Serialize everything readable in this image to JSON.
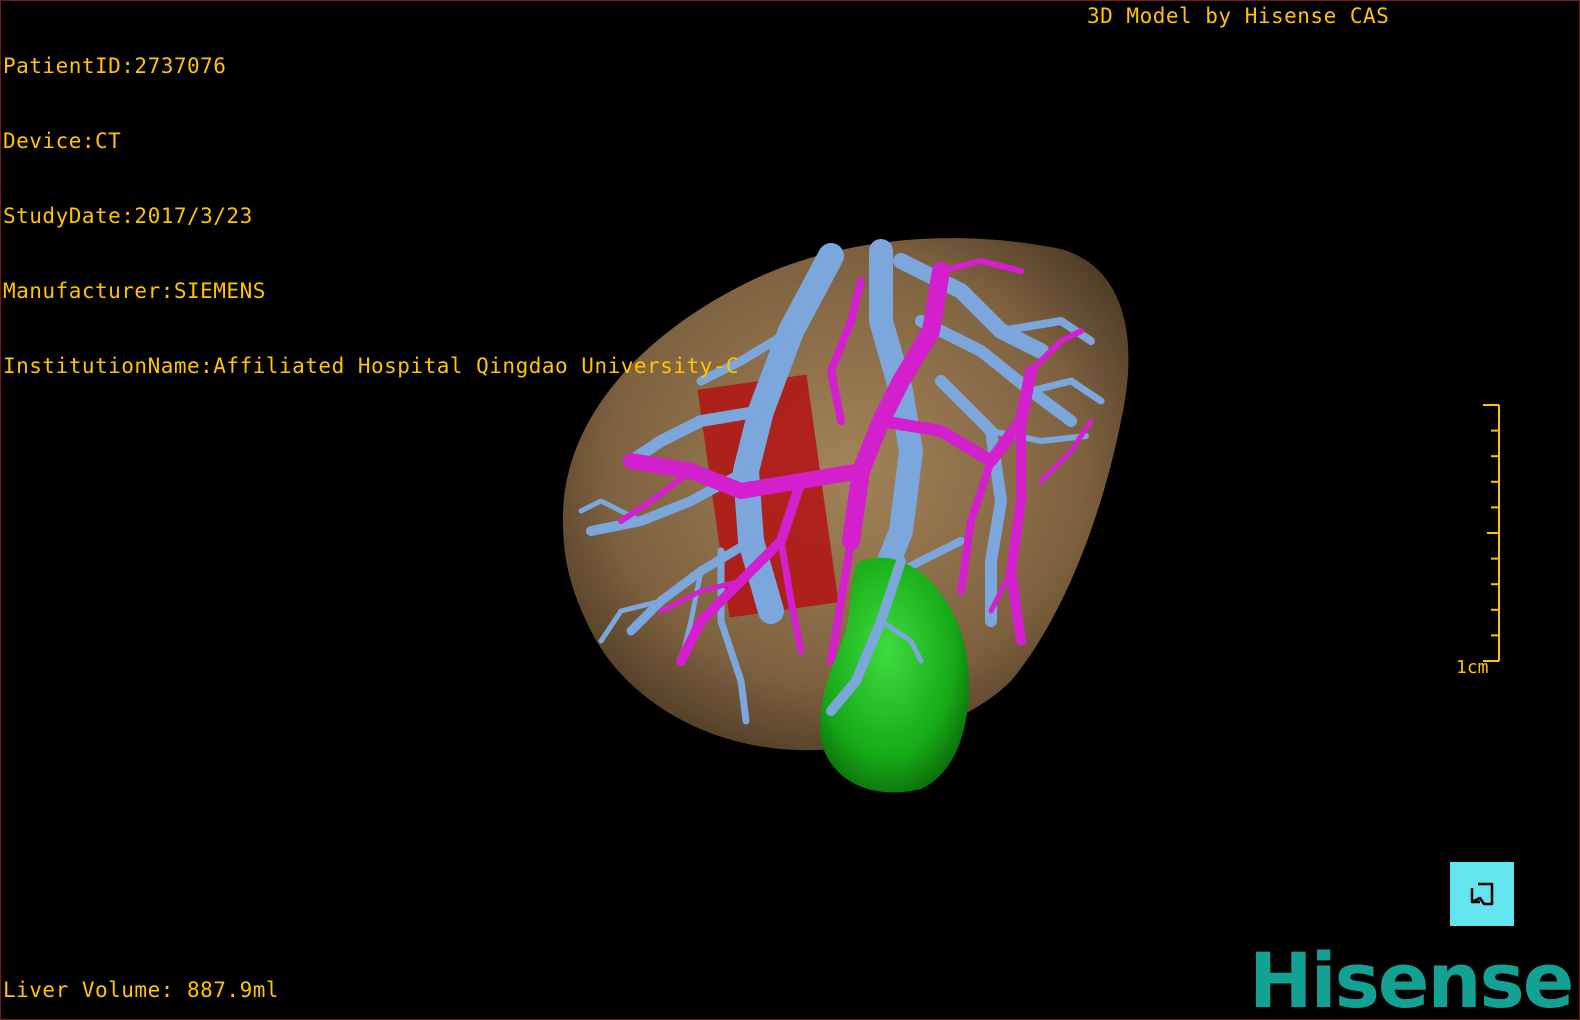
{
  "header": {
    "patient_id": "PatientID:2737076",
    "device": "Device:CT",
    "study_date": "StudyDate:2017/3/23",
    "manufacturer": "Manufacturer:SIEMENS",
    "institution": "InstitutionName:Affiliated Hospital Qingdao University-C",
    "credit": "3D Model by Hisense CAS"
  },
  "footer": {
    "liver_volume": "Liver Volume: 887.9ml"
  },
  "scale_bar": {
    "label": "1cm"
  },
  "orientation_button": {
    "icon": "orientation-cube-icon"
  },
  "logo": {
    "text": "Hisense"
  },
  "colors": {
    "overlay_text": "#ffc400",
    "liver": "#8a6a44",
    "portal_vein": "#7aa6dc",
    "hepatic_vein": "#d81fd2",
    "gallbladder": "#17b417",
    "logo": "#12a192",
    "button": "#62e5ee"
  }
}
